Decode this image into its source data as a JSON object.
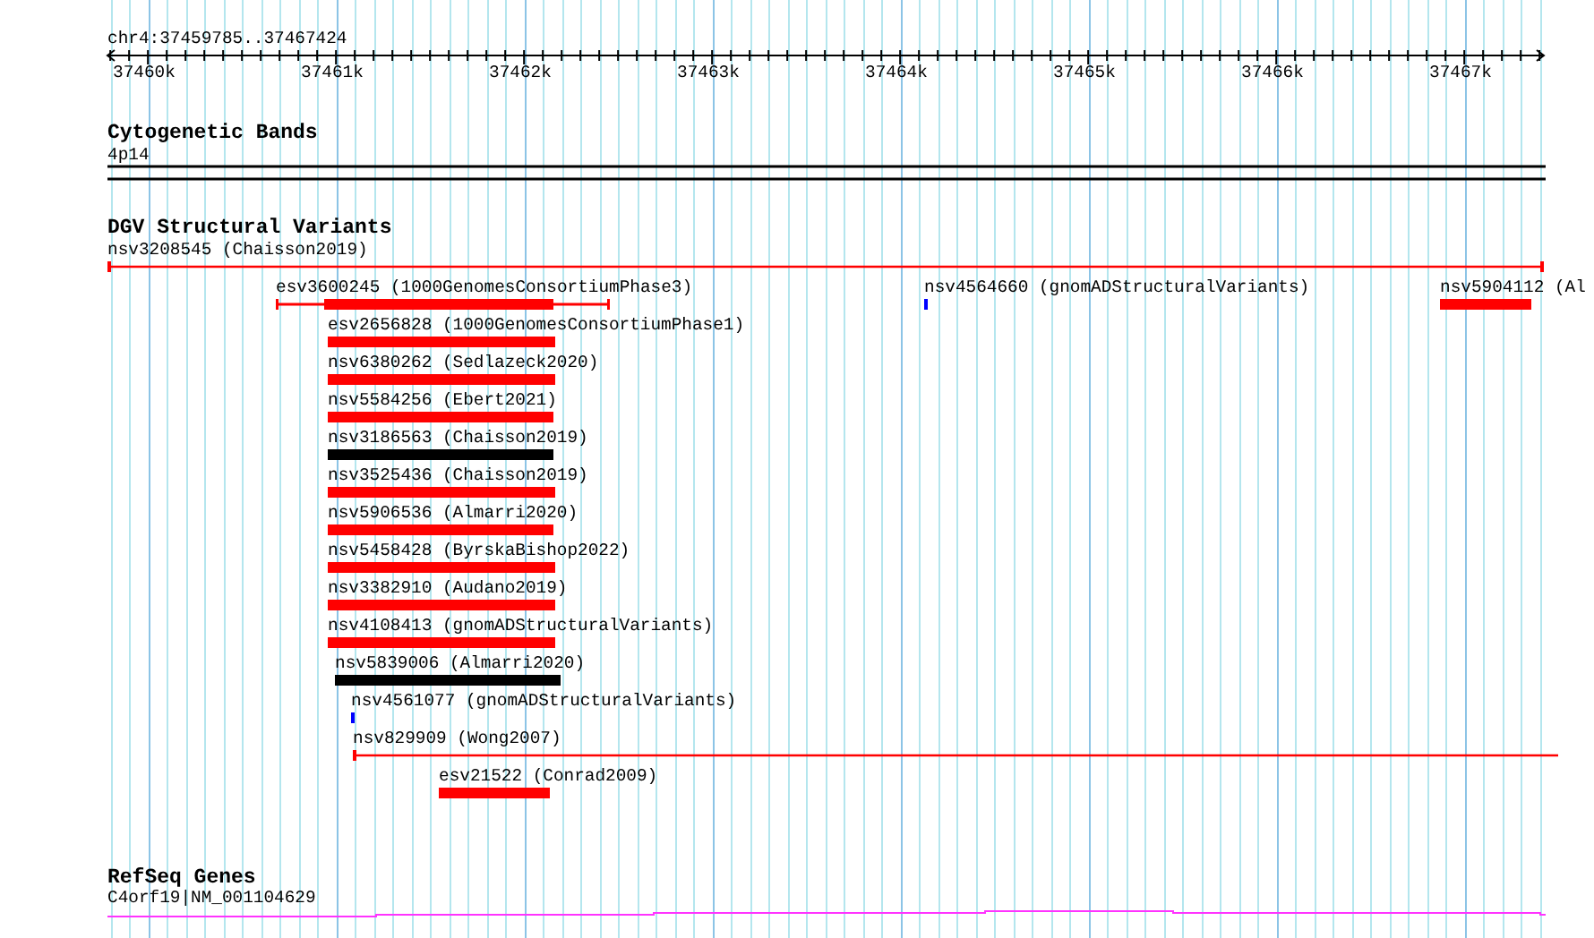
{
  "ruler": {
    "location": "chr4:37459785..37467424",
    "ticks": [
      "37460k",
      "37461k",
      "37462k",
      "37463k",
      "37464k",
      "37465k",
      "37466k",
      "37467k"
    ]
  },
  "tracks": [
    {
      "kind": "bands",
      "title": "Cytogenetic Bands",
      "features": [
        {
          "label": "4p14"
        }
      ]
    },
    {
      "kind": "variants",
      "title": "DGV Structural Variants",
      "features": [
        {
          "label": "nsv3208545 (Chaisson2019)",
          "kind": "line",
          "color": "#ff0000"
        },
        {
          "label": "esv3600245 (1000GenomesConsortiumPhase3)",
          "kind": "whisker",
          "color": "#ff0000"
        },
        {
          "label": "nsv4564660 (gnomADStructuralVariants)",
          "kind": "point",
          "color": "#0000ff"
        },
        {
          "label": "nsv5904112 (Al",
          "kind": "box",
          "color": "#ff0000"
        },
        {
          "label": "esv2656828 (1000GenomesConsortiumPhase1)",
          "kind": "box",
          "color": "#ff0000"
        },
        {
          "label": "nsv6380262 (Sedlazeck2020)",
          "kind": "box",
          "color": "#ff0000"
        },
        {
          "label": "nsv5584256 (Ebert2021)",
          "kind": "box",
          "color": "#ff0000"
        },
        {
          "label": "nsv3186563 (Chaisson2019)",
          "kind": "box",
          "color": "#000000"
        },
        {
          "label": "nsv3525436 (Chaisson2019)",
          "kind": "box",
          "color": "#ff0000"
        },
        {
          "label": "nsv5906536 (Almarri2020)",
          "kind": "box",
          "color": "#ff0000"
        },
        {
          "label": "nsv5458428 (ByrskaBishop2022)",
          "kind": "box",
          "color": "#ff0000"
        },
        {
          "label": "nsv3382910 (Audano2019)",
          "kind": "box",
          "color": "#ff0000"
        },
        {
          "label": "nsv4108413 (gnomADStructuralVariants)",
          "kind": "box",
          "color": "#ff0000"
        },
        {
          "label": "nsv5839006 (Almarri2020)",
          "kind": "box",
          "color": "#000000"
        },
        {
          "label": "nsv4561077 (gnomADStructuralVariants)",
          "kind": "point",
          "color": "#0000ff"
        },
        {
          "label": "nsv829909 (Wong2007)",
          "kind": "line",
          "color": "#ff0000"
        },
        {
          "label": "esv21522 (Conrad2009)",
          "kind": "box",
          "color": "#ff0000"
        }
      ]
    },
    {
      "kind": "genes",
      "title": "RefSeq Genes",
      "features": [
        {
          "label": "C4orf19|NM_001104629"
        }
      ]
    }
  ]
}
